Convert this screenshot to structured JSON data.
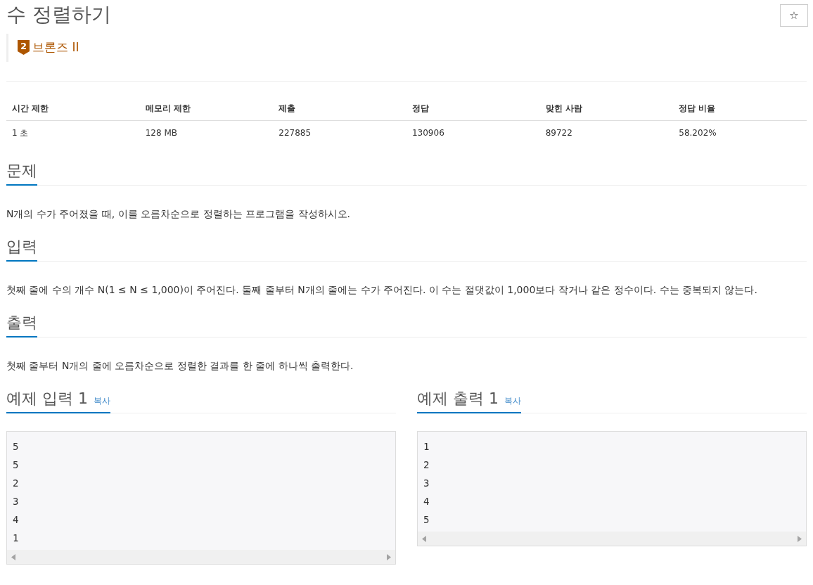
{
  "title": "수 정렬하기",
  "star_button": "☆",
  "tier": {
    "number": "2",
    "label": "브론즈 II"
  },
  "limits": {
    "columns": [
      "시간 제한",
      "메모리 제한",
      "제출",
      "정답",
      "맞힌 사람",
      "정답 비율"
    ],
    "rows": [
      [
        "1 초",
        "128 MB",
        "227885",
        "130906",
        "89722",
        "58.202%"
      ]
    ]
  },
  "sections": [
    {
      "heading": "문제",
      "text": "N개의 수가 주어졌을 때, 이를 오름차순으로 정렬하는 프로그램을 작성하시오."
    },
    {
      "heading": "입력",
      "text": "첫째 줄에 수의 개수 N(1 ≤ N ≤ 1,000)이 주어진다. 둘째 줄부터 N개의 줄에는 수가 주어진다. 이 수는 절댓값이 1,000보다 작거나 같은 정수이다. 수는 중복되지 않는다."
    },
    {
      "heading": "출력",
      "text": "첫째 줄부터 N개의 줄에 오름차순으로 정렬한 결과를 한 줄에 하나씩 출력한다."
    }
  ],
  "samples": [
    {
      "heading": "예제 입력 1",
      "copy": "복사",
      "lines": [
        "5",
        "5",
        "2",
        "3",
        "4",
        "1"
      ]
    },
    {
      "heading": "예제 출력 1",
      "copy": "복사",
      "lines": [
        "1",
        "2",
        "3",
        "4",
        "5"
      ]
    }
  ]
}
